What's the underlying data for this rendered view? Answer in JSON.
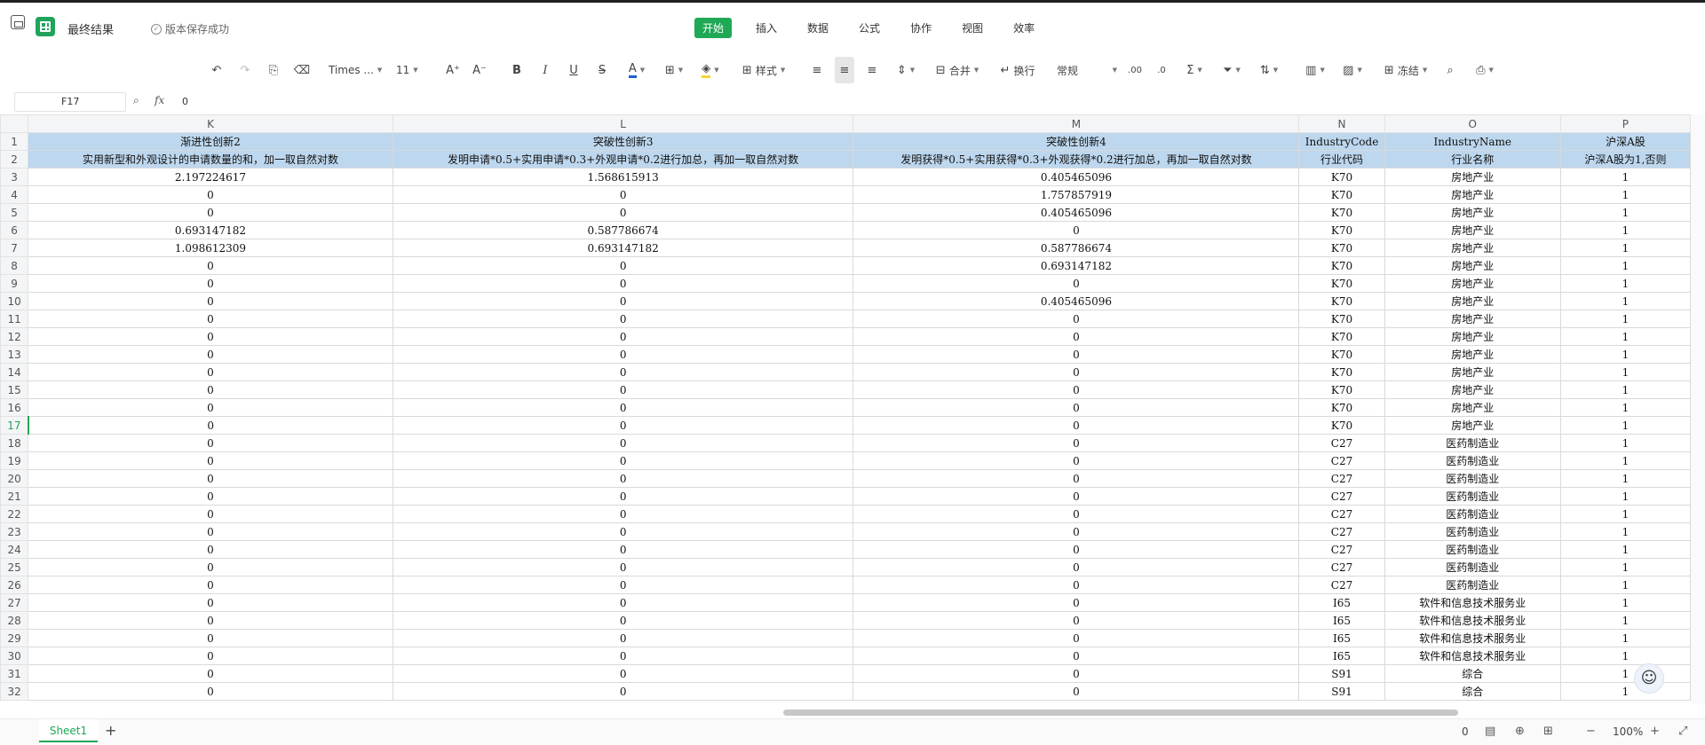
{
  "titlebar": {
    "doc_title": "最终结果",
    "save_status": "版本保存成功",
    "menu_tabs": [
      {
        "label": "开始",
        "active": true
      },
      {
        "label": "插入"
      },
      {
        "label": "数据"
      },
      {
        "label": "公式"
      },
      {
        "label": "协作"
      },
      {
        "label": "视图"
      },
      {
        "label": "效率"
      }
    ]
  },
  "toolbar": {
    "font_name": "Times ...",
    "font_size": "11",
    "style_label": "样式",
    "merge_label": "合并",
    "wrap_label": "换行",
    "number_format": "常规",
    "freeze_label": "冻结",
    "accent_color": "#1fa855",
    "font_color_bar": "#1a5fd6",
    "fill_color_bar": "#f5d63b"
  },
  "formula_bar": {
    "cell_ref": "F17",
    "value": "0"
  },
  "sheet": {
    "columns": [
      "K",
      "L",
      "M",
      "N",
      "O",
      "P"
    ],
    "header_fill": "#bdd7ee",
    "rows": [
      {
        "n": "1",
        "hdr": true,
        "cells": [
          "渐进性创新2",
          "突破性创新3",
          "突破性创新4",
          "IndustryCode",
          "IndustryName",
          "沪深A股"
        ]
      },
      {
        "n": "2",
        "hdr": true,
        "cells": [
          "实用新型和外观设计的申请数量的和，加一取自然对数",
          "发明申请*0.5+实用申请*0.3+外观申请*0.2进行加总，再加一取自然对数",
          "发明获得*0.5+实用获得*0.3+外观获得*0.2进行加总，再加一取自然对数",
          "行业代码",
          "行业名称",
          "沪深A股为1,否则"
        ]
      },
      {
        "n": "3",
        "cells": [
          "2.197224617",
          "1.568615913",
          "0.405465096",
          "K70",
          "房地产业",
          "1"
        ]
      },
      {
        "n": "4",
        "cells": [
          "0",
          "0",
          "1.757857919",
          "K70",
          "房地产业",
          "1"
        ]
      },
      {
        "n": "5",
        "cells": [
          "0",
          "0",
          "0.405465096",
          "K70",
          "房地产业",
          "1"
        ]
      },
      {
        "n": "6",
        "cells": [
          "0.693147182",
          "0.587786674",
          "0",
          "K70",
          "房地产业",
          "1"
        ]
      },
      {
        "n": "7",
        "cells": [
          "1.098612309",
          "0.693147182",
          "0.587786674",
          "K70",
          "房地产业",
          "1"
        ]
      },
      {
        "n": "8",
        "cells": [
          "0",
          "0",
          "0.693147182",
          "K70",
          "房地产业",
          "1"
        ]
      },
      {
        "n": "9",
        "cells": [
          "0",
          "0",
          "0",
          "K70",
          "房地产业",
          "1"
        ]
      },
      {
        "n": "10",
        "cells": [
          "0",
          "0",
          "0.405465096",
          "K70",
          "房地产业",
          "1"
        ]
      },
      {
        "n": "11",
        "cells": [
          "0",
          "0",
          "0",
          "K70",
          "房地产业",
          "1"
        ]
      },
      {
        "n": "12",
        "cells": [
          "0",
          "0",
          "0",
          "K70",
          "房地产业",
          "1"
        ]
      },
      {
        "n": "13",
        "cells": [
          "0",
          "0",
          "0",
          "K70",
          "房地产业",
          "1"
        ]
      },
      {
        "n": "14",
        "cells": [
          "0",
          "0",
          "0",
          "K70",
          "房地产业",
          "1"
        ]
      },
      {
        "n": "15",
        "cells": [
          "0",
          "0",
          "0",
          "K70",
          "房地产业",
          "1"
        ]
      },
      {
        "n": "16",
        "cells": [
          "0",
          "0",
          "0",
          "K70",
          "房地产业",
          "1"
        ]
      },
      {
        "n": "17",
        "active": true,
        "cells": [
          "0",
          "0",
          "0",
          "K70",
          "房地产业",
          "1"
        ]
      },
      {
        "n": "18",
        "cells": [
          "0",
          "0",
          "0",
          "C27",
          "医药制造业",
          "1"
        ]
      },
      {
        "n": "19",
        "cells": [
          "0",
          "0",
          "0",
          "C27",
          "医药制造业",
          "1"
        ]
      },
      {
        "n": "20",
        "cells": [
          "0",
          "0",
          "0",
          "C27",
          "医药制造业",
          "1"
        ]
      },
      {
        "n": "21",
        "cells": [
          "0",
          "0",
          "0",
          "C27",
          "医药制造业",
          "1"
        ]
      },
      {
        "n": "22",
        "cells": [
          "0",
          "0",
          "0",
          "C27",
          "医药制造业",
          "1"
        ]
      },
      {
        "n": "23",
        "cells": [
          "0",
          "0",
          "0",
          "C27",
          "医药制造业",
          "1"
        ]
      },
      {
        "n": "24",
        "cells": [
          "0",
          "0",
          "0",
          "C27",
          "医药制造业",
          "1"
        ]
      },
      {
        "n": "25",
        "cells": [
          "0",
          "0",
          "0",
          "C27",
          "医药制造业",
          "1"
        ]
      },
      {
        "n": "26",
        "cells": [
          "0",
          "0",
          "0",
          "C27",
          "医药制造业",
          "1"
        ]
      },
      {
        "n": "27",
        "cells": [
          "0",
          "0",
          "0",
          "I65",
          "软件和信息技术服务业",
          "1"
        ]
      },
      {
        "n": "28",
        "cells": [
          "0",
          "0",
          "0",
          "I65",
          "软件和信息技术服务业",
          "1"
        ]
      },
      {
        "n": "29",
        "cells": [
          "0",
          "0",
          "0",
          "I65",
          "软件和信息技术服务业",
          "1"
        ]
      },
      {
        "n": "30",
        "cells": [
          "0",
          "0",
          "0",
          "I65",
          "软件和信息技术服务业",
          "1"
        ]
      },
      {
        "n": "31",
        "cells": [
          "0",
          "0",
          "0",
          "S91",
          "综合",
          "1"
        ]
      },
      {
        "n": "32",
        "cells": [
          "0",
          "0",
          "0",
          "S91",
          "综合",
          "1"
        ]
      }
    ]
  },
  "bottom": {
    "sheet_tab": "Sheet1",
    "add_sheet": "+",
    "count": "0",
    "zoom": "100%"
  }
}
